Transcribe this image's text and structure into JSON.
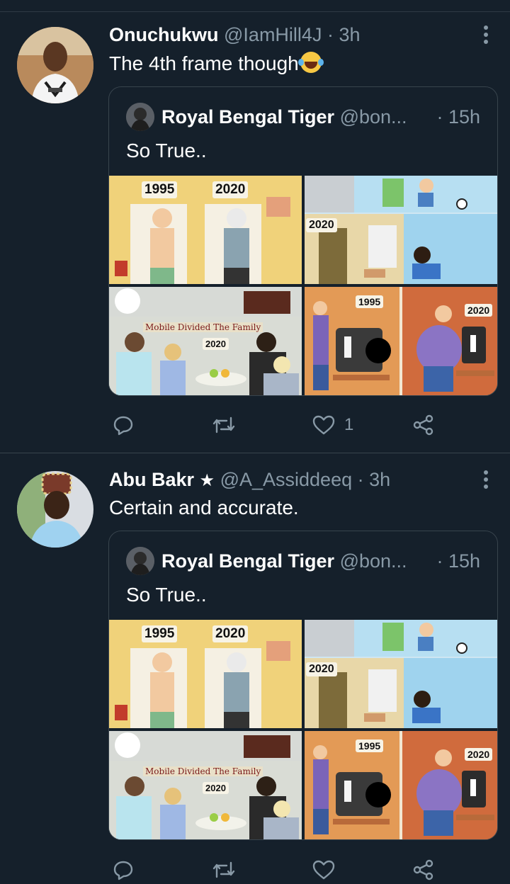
{
  "tweets": [
    {
      "name": "Onuchukwu",
      "handle": "@IamHill4J",
      "sep": "·",
      "time": "3h",
      "text": "The 4th frame though",
      "emoji": "tears-of-joy-emoji",
      "quote": {
        "name": "Royal Bengal Tiger",
        "handle": "@bon...",
        "time": "· 15h",
        "text": "So True..",
        "image_labels": {
          "y1995": "1995",
          "y2020a": "2020",
          "y2020b": "2020",
          "caption": "Mobile Divided The Family",
          "y2020c": "2020",
          "y1995b": "1995",
          "y2020d": "2020"
        }
      },
      "actions": {
        "reply": "",
        "retweet": "",
        "like": "1",
        "share": ""
      }
    },
    {
      "name": "Abu Bakr",
      "star": "★",
      "handle": "@A_Assiddeeq",
      "sep": "·",
      "time": "3h",
      "text": "Certain and accurate.",
      "quote": {
        "name": "Royal Bengal Tiger",
        "handle": "@bon...",
        "time": "· 15h",
        "text": "So True..",
        "image_labels": {
          "y1995": "1995",
          "y2020a": "2020",
          "y2020b": "2020",
          "caption": "Mobile Divided The Family",
          "y2020c": "2020",
          "y1995b": "1995",
          "y2020d": "2020"
        }
      },
      "actions": {
        "reply": "",
        "retweet": "",
        "like": "",
        "share": ""
      }
    }
  ],
  "colors": {
    "background": "#15202b",
    "secondary_text": "#8899a6",
    "border": "#38444d"
  }
}
